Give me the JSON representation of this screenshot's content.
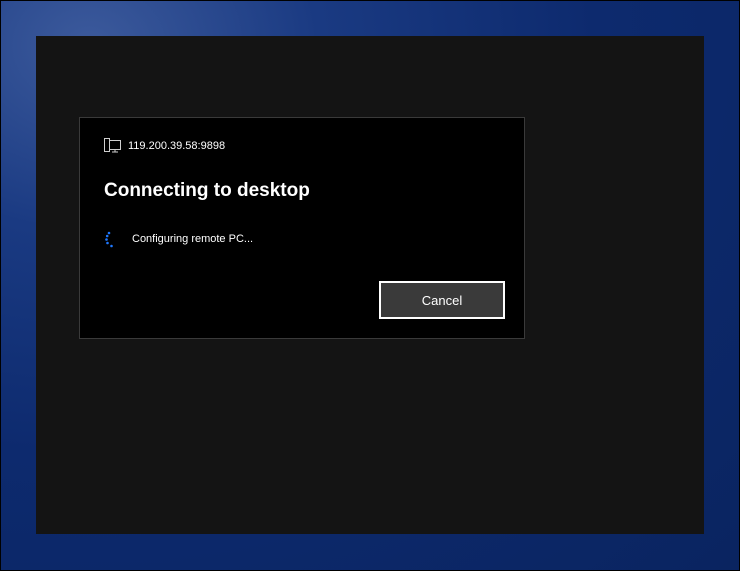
{
  "dialog": {
    "host": "119.200.39.58:9898",
    "title": "Connecting to desktop",
    "status": "Configuring remote PC...",
    "cancel_label": "Cancel",
    "icons": {
      "host": "remote-pc-icon",
      "status": "progress-spinner-icon"
    }
  },
  "colors": {
    "desktop_background": "#0d2a6e",
    "remote_window": "#141414",
    "dialog_background": "#000000",
    "accent_spinner": "#1e78ff",
    "button_background": "#3a3a3a"
  }
}
